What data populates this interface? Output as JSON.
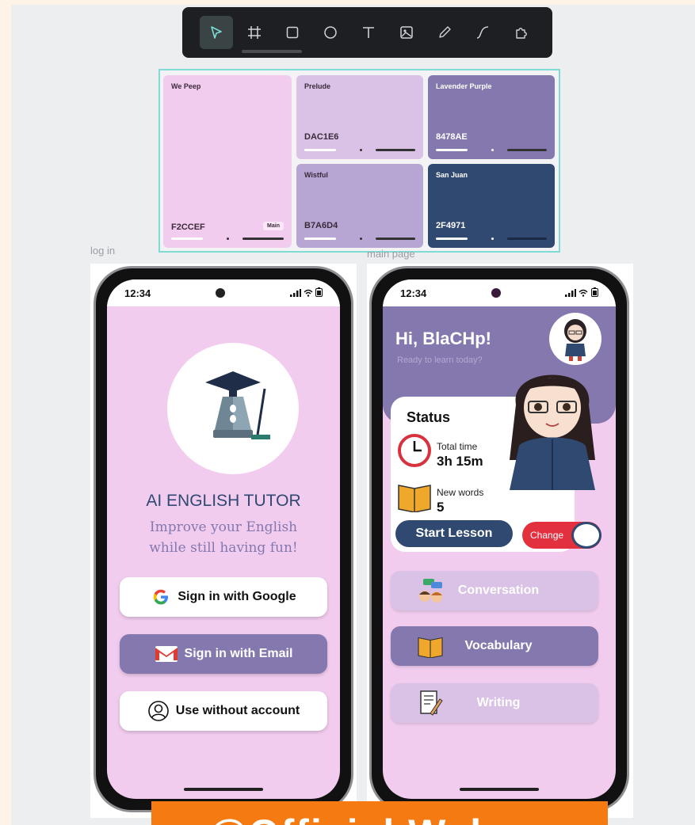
{
  "toolbar": {
    "tools": [
      "select-icon",
      "frame-icon",
      "rectangle-icon",
      "ellipse-icon",
      "text-icon",
      "image-icon",
      "pen-icon",
      "path-icon",
      "plugin-icon"
    ],
    "active": "select-icon"
  },
  "palette": {
    "swatches": [
      {
        "name": "We Peep",
        "hex": "F2CCEF",
        "color": "#f2ccef",
        "tag": "Main"
      },
      {
        "name": "Prelude",
        "hex": "DAC1E6",
        "color": "#dac1e6"
      },
      {
        "name": "Lavender Purple",
        "hex": "8478AE",
        "color": "#8478ae"
      },
      {
        "name": "Wistful",
        "hex": "B7A6D4",
        "color": "#b7a6d4"
      },
      {
        "name": "San Juan",
        "hex": "2F4971",
        "color": "#2f4971"
      }
    ]
  },
  "labels": {
    "login_frame": "log in",
    "main_frame": "main page"
  },
  "login": {
    "time": "12:34",
    "title": "AI ENGLISH TUTOR",
    "tagline_line1": "Improve your English",
    "tagline_line2": "while still having fun!",
    "google_button": "Sign in with Google",
    "email_button": "Sign in with Email",
    "guest_button": "Use without account"
  },
  "main": {
    "time": "12:34",
    "greeting": "Hi, BlaCHp!",
    "subtitle": "Ready to learn today?",
    "status_title": "Status",
    "total_time_label": "Total time",
    "total_time_value": "3h 15m",
    "new_words_label": "New words",
    "new_words_value": "5",
    "start_button": "Start Lesson",
    "change_button": "Change",
    "menu": {
      "conversation": "Conversation",
      "vocabulary": "Vocabulary",
      "writing": "Writing"
    }
  },
  "banner": {
    "text": "@Official Web"
  }
}
